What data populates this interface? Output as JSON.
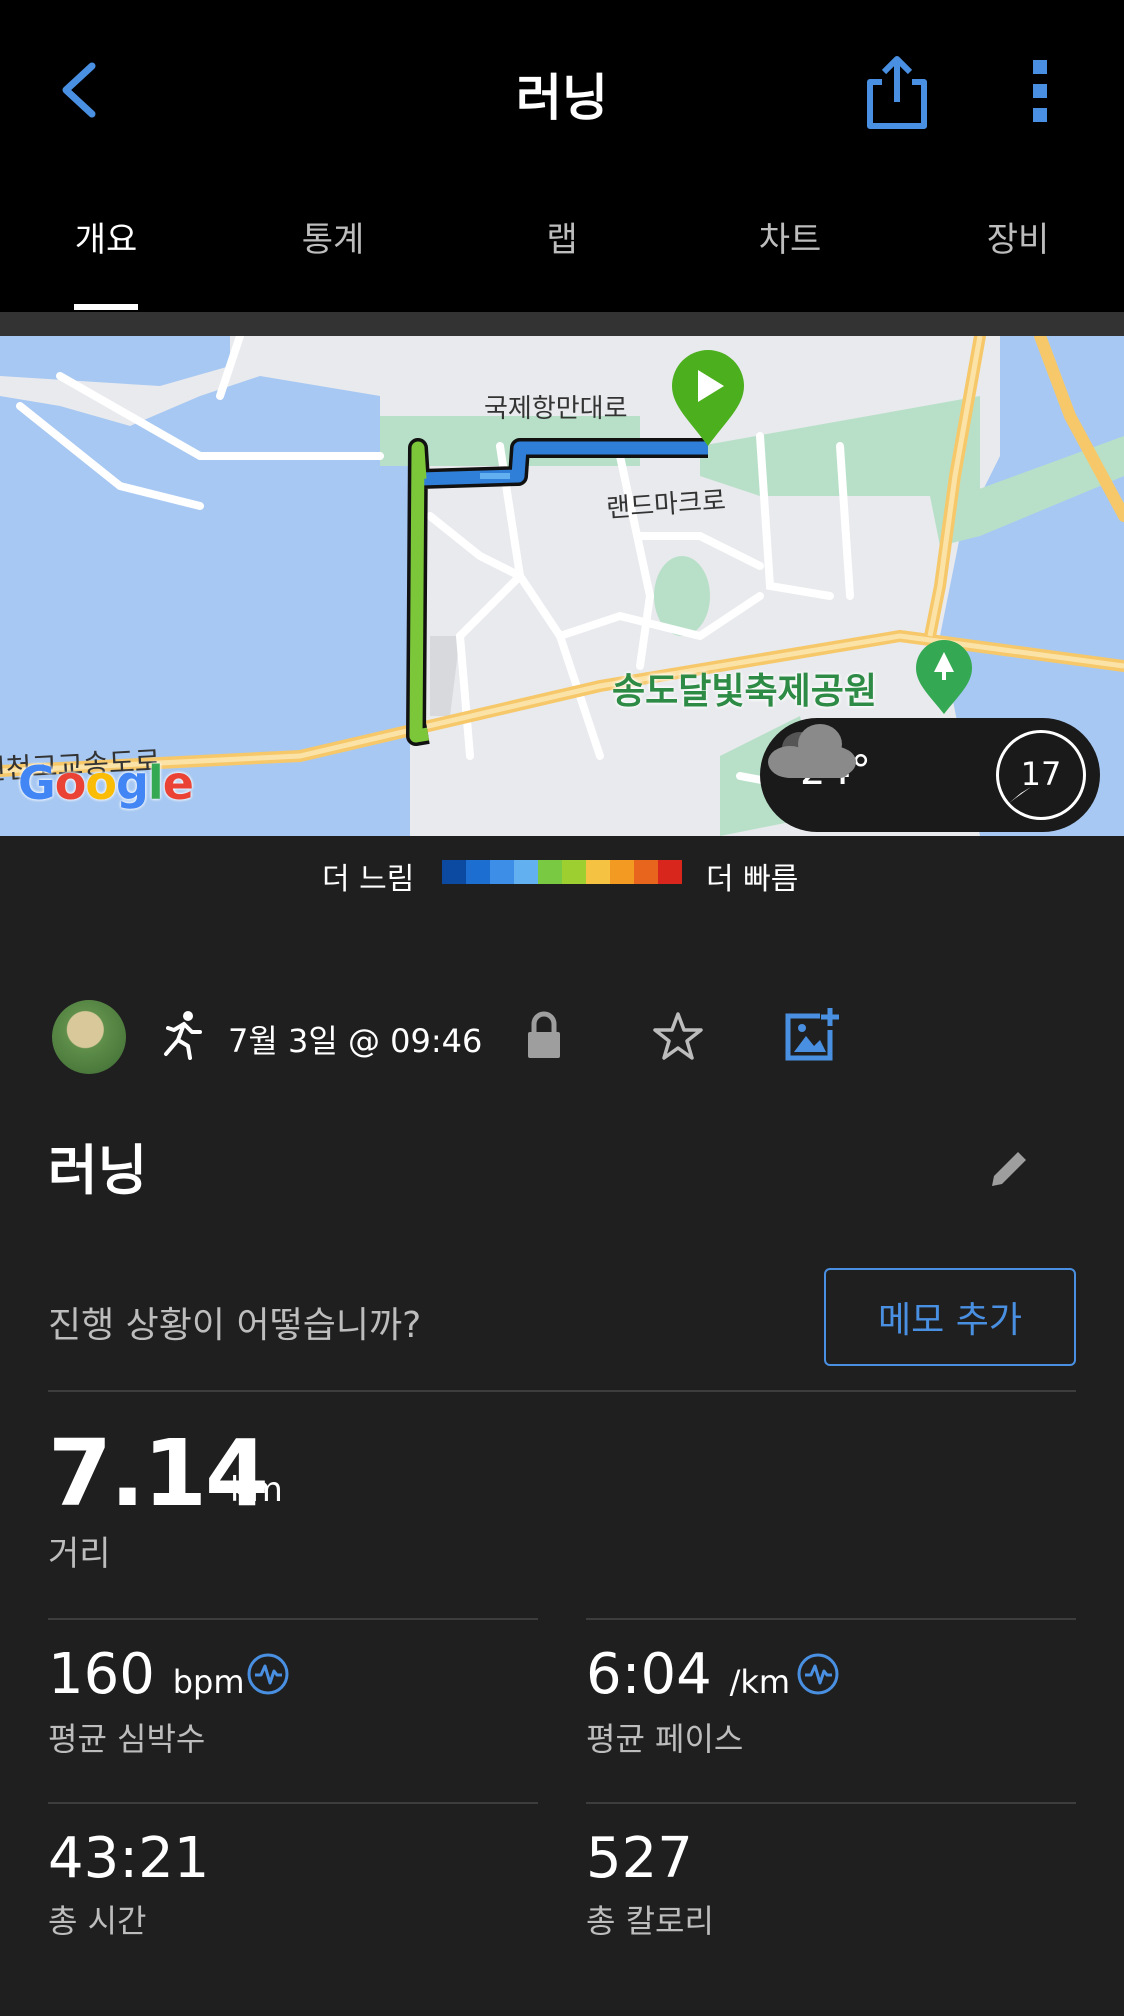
{
  "header": {
    "title": "러닝",
    "back_icon": "chevron-left-icon",
    "share_icon": "share-icon",
    "more_icon": "more-vertical-icon"
  },
  "tabs": [
    {
      "label": "개요",
      "active": true
    },
    {
      "label": "통계",
      "active": false
    },
    {
      "label": "랩",
      "active": false
    },
    {
      "label": "차트",
      "active": false
    },
    {
      "label": "장비",
      "active": false
    }
  ],
  "map": {
    "street_labels": [
      "국제항만대로",
      "랜드마크로"
    ],
    "park_label": "송도달빛축제공원",
    "partial_label": "인천고교송도로",
    "provider": "Google",
    "weather": {
      "temperature": "24°",
      "wind": "17",
      "icon": "cloud-icon"
    }
  },
  "legend": {
    "slow": "더 느림",
    "fast": "더 빠름",
    "colors": [
      "#0b4aa0",
      "#1c6fd0",
      "#3d8ee6",
      "#63b0f0",
      "#7ac943",
      "#9ccf2f",
      "#f5c242",
      "#f39a22",
      "#e8651e",
      "#d9261c"
    ]
  },
  "activity": {
    "date": "7월 3일 @ 09:46",
    "name": "러닝",
    "prompt": "진행 상황이 어떻습니까?",
    "memo_button": "메모 추가"
  },
  "stats": {
    "distance": {
      "value": "7.14",
      "unit": "km",
      "label": "거리"
    },
    "heart_rate": {
      "value": "160",
      "unit": "bpm",
      "label": "평균 심박수"
    },
    "pace": {
      "value": "6:04",
      "unit": "/km",
      "label": "평균 페이스"
    },
    "time": {
      "value": "43:21",
      "label": "총 시간"
    },
    "calories": {
      "value": "527",
      "label": "총 칼로리"
    }
  },
  "colors": {
    "accent": "#4a90e2",
    "background": "#1f1f1f",
    "header": "#000000",
    "start_marker": "#4caf1e"
  }
}
